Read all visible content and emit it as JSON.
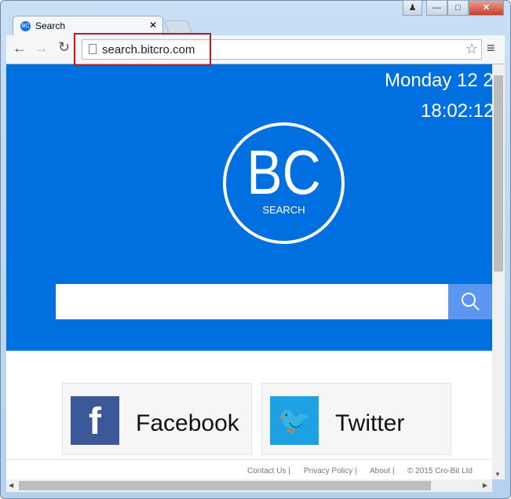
{
  "browser": {
    "tab_title": "Search",
    "tab_favicon": "BC",
    "url": "search.bitcro.com"
  },
  "hero": {
    "date": "Monday 12 2",
    "time": "18:02:12",
    "logo_text": "BC",
    "logo_sub": "SEARCH",
    "search_placeholder": "",
    "color": "#0070e0"
  },
  "social": [
    {
      "label": "Facebook",
      "icon": "facebook-icon",
      "color": "#3b5998"
    },
    {
      "label": "Twitter",
      "icon": "twitter-icon",
      "color": "#1da1e2"
    }
  ],
  "footer": {
    "contact": "Contact Us |",
    "privacy": "Privacy Policy |",
    "about": "About |",
    "copyright": "© 2015 Cro-Bit Ltd"
  }
}
